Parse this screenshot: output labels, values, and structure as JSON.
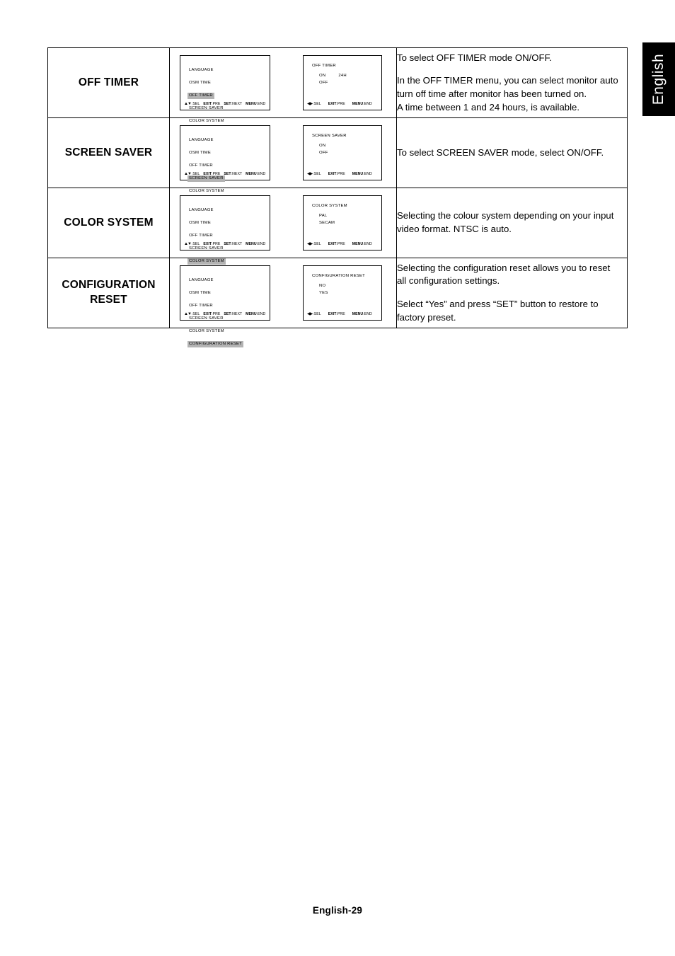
{
  "page": {
    "language_tab": "English",
    "footer": "English-29"
  },
  "osd_menu": {
    "items": [
      "LANGUAGE",
      "OSM TIME",
      "OFF TIMER",
      "SCREEN SAVER",
      "COLOR SYSTEM",
      "CONFIGURATION RESET"
    ],
    "footer_menu": {
      "arrows": "▲▼",
      "sel": ":SEL ",
      "exit": "EXIT",
      "exit_val": ":PRE ",
      "set": "SET",
      "set_val": ":NEXT ",
      "menu": "MENU",
      "menu_val": ":END"
    },
    "footer_sub": {
      "arrows": "◀▶",
      "sel": ":SEL",
      "exit": "EXIT",
      "exit_val": ":PRE",
      "menu": "MENU",
      "menu_val": ":END"
    },
    "highlight_color": "#b3b3b3"
  },
  "rows": [
    {
      "label": "OFF TIMER",
      "label_line2": "",
      "highlight_index": 2,
      "sub": {
        "title": "OFF TIMER",
        "options": [
          {
            "name": "ON",
            "value": "24H"
          },
          {
            "name": "OFF",
            "value": ""
          }
        ]
      },
      "description": [
        "To select OFF TIMER mode ON/OFF.",
        "",
        "In the OFF TIMER menu, you can select monitor auto",
        "turn off time after monitor has been turned on.",
        "A time between 1 and 24 hours, is available."
      ]
    },
    {
      "label": "SCREEN SAVER",
      "label_line2": "",
      "highlight_index": 3,
      "sub": {
        "title": "SCREEN SAVER",
        "options": [
          {
            "name": "ON",
            "value": ""
          },
          {
            "name": "OFF",
            "value": ""
          }
        ]
      },
      "description": [
        "To select SCREEN SAVER mode, select ON/OFF."
      ]
    },
    {
      "label": "COLOR SYSTEM",
      "label_line2": "",
      "highlight_index": 4,
      "sub": {
        "title": "COLOR SYSTEM",
        "options": [
          {
            "name": "PAL",
            "value": ""
          },
          {
            "name": "SECAM",
            "value": ""
          }
        ]
      },
      "description": [
        "Selecting the colour system depending on your input",
        "video format. NTSC is auto."
      ]
    },
    {
      "label": "CONFIGURATION",
      "label_line2": "RESET",
      "highlight_index": 5,
      "sub": {
        "title": "CONFIGURATION RESET",
        "options": [
          {
            "name": "NO",
            "value": ""
          },
          {
            "name": "YES",
            "value": ""
          }
        ]
      },
      "description": [
        "Selecting the configuration reset allows you to reset",
        "all configuration settings.",
        "",
        "Select “Yes” and press “SET” button to restore to",
        "factory preset."
      ]
    }
  ]
}
